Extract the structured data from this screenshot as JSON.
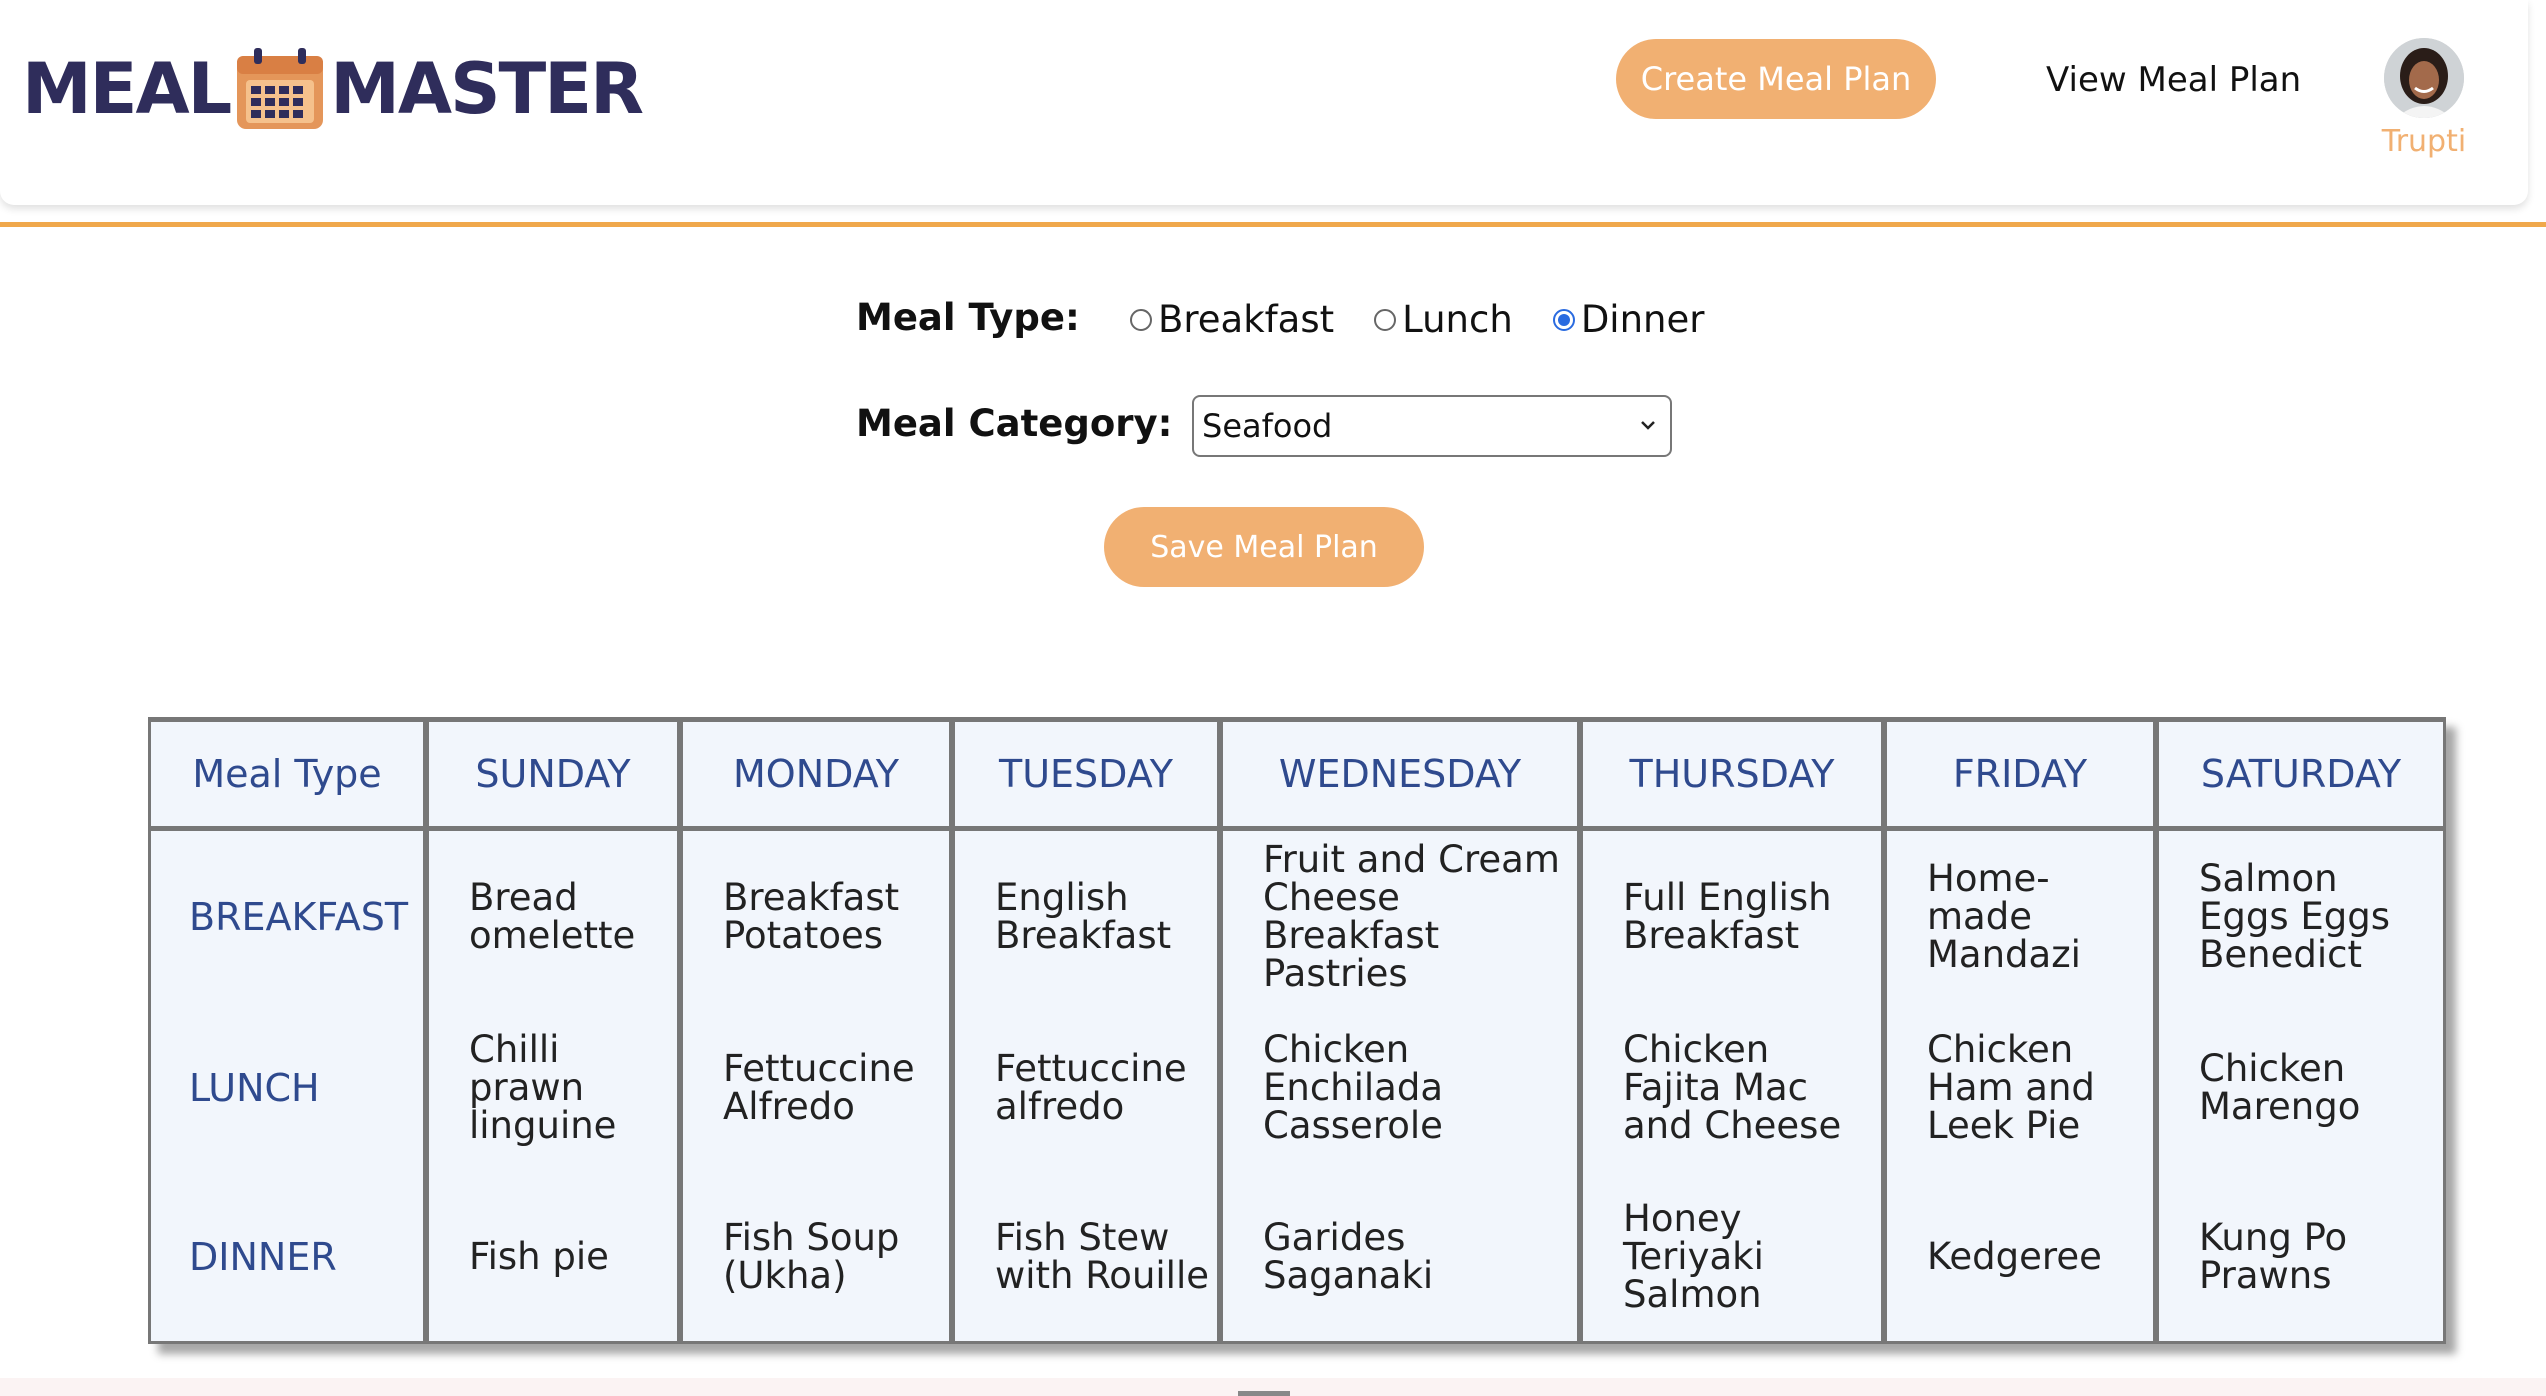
{
  "header": {
    "logo_left": "MEAL",
    "logo_right": "MASTER",
    "logo_icon": "calendar-icon",
    "create_button": "Create Meal Plan",
    "view_link": "View Meal Plan",
    "user_name": "Trupti"
  },
  "form": {
    "meal_type_label": "Meal Type:",
    "meal_type_options": [
      "Breakfast",
      "Lunch",
      "Dinner"
    ],
    "meal_type_selected": "Dinner",
    "meal_category_label": "Meal Category:",
    "meal_category_value": "Seafood",
    "save_button": "Save Meal Plan"
  },
  "table": {
    "headers": [
      "Meal Type",
      "SUNDAY",
      "MONDAY",
      "TUESDAY",
      "WEDNESDAY",
      "THURSDAY",
      "FRIDAY",
      "SATURDAY"
    ],
    "rows": [
      {
        "meal": "BREAKFAST",
        "cells": [
          "Bread omelette",
          "Breakfast Potatoes",
          "English Breakfast",
          "Fruit and Cream Cheese Breakfast Pastries",
          "Full English Breakfast",
          "Home-made Mandazi",
          "Salmon Eggs Eggs Benedict"
        ]
      },
      {
        "meal": "LUNCH",
        "cells": [
          "Chilli prawn linguine",
          "Fettuccine Alfredo",
          "Fettuccine alfredo",
          "Chicken Enchilada Casserole",
          "Chicken Fajita Mac and Cheese",
          "Chicken Ham and Leek Pie",
          "Chicken Marengo"
        ]
      },
      {
        "meal": "DINNER",
        "cells": [
          "Fish pie",
          "Fish Soup (Ukha)",
          "Fish Stew with Rouille",
          "Garides Saganaki",
          "Honey Teriyaki Salmon",
          "Kedgeree",
          "Kung Po Prawns"
        ]
      }
    ]
  },
  "colors": {
    "accent": "#f1b072",
    "brand_dark": "#2f2d5b",
    "table_header_text": "#2f4a8e",
    "divider": "#f0a84b"
  }
}
